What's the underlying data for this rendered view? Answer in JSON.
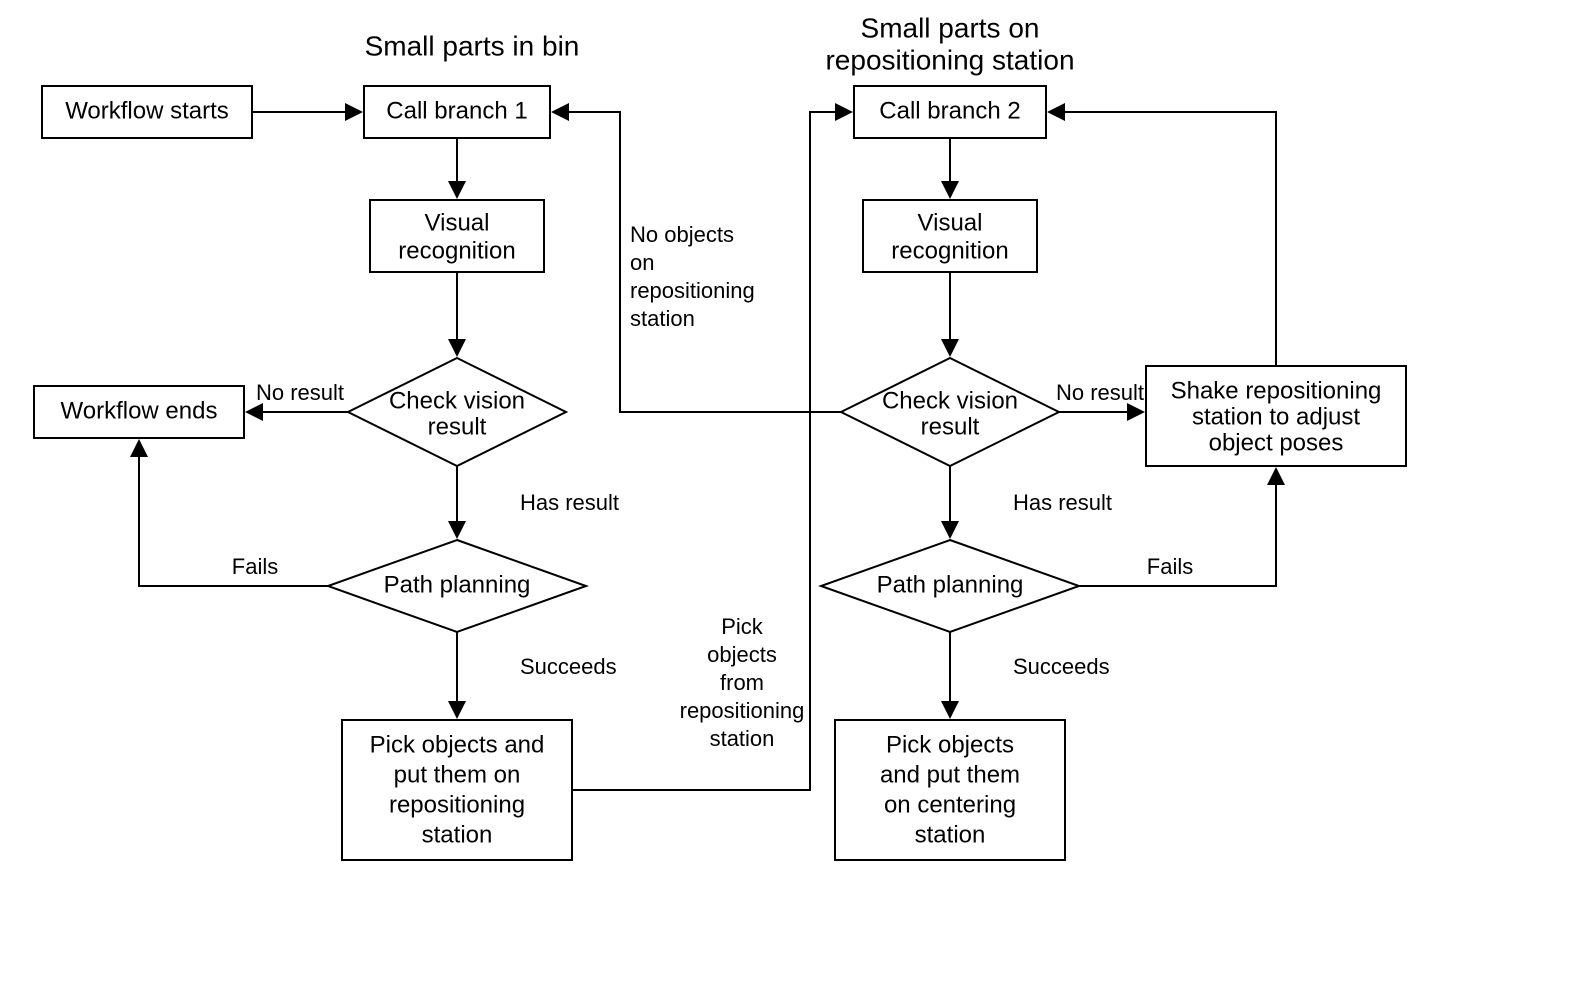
{
  "titles": {
    "left": "Small parts in bin",
    "right_l1": "Small parts on",
    "right_l2": "repositioning station"
  },
  "nodes": {
    "start": {
      "text": "Workflow starts"
    },
    "call1": {
      "text": "Call branch 1"
    },
    "vis1_l1": "Visual",
    "vis1_l2": "recognition",
    "chk1_l1": "Check vision",
    "chk1_l2": "result",
    "plan1": "Path planning",
    "pick1_l1": "Pick objects and",
    "pick1_l2": "put them on",
    "pick1_l3": "repositioning",
    "pick1_l4": "station",
    "end": {
      "text": "Workflow ends"
    },
    "call2": {
      "text": "Call branch 2"
    },
    "vis2_l1": "Visual",
    "vis2_l2": "recognition",
    "chk2_l1": "Check vision",
    "chk2_l2": "result",
    "plan2": "Path planning",
    "pick2_l1": "Pick objects",
    "pick2_l2": "and put them",
    "pick2_l3": "on centering",
    "pick2_l4": "station",
    "shake_l1": "Shake repositioning",
    "shake_l2": "station to adjust",
    "shake_l3": "object poses"
  },
  "labels": {
    "no_result": "No result",
    "has_result": "Has result",
    "fails": "Fails",
    "succeeds": "Succeeds",
    "noobj_l1": "No objects",
    "noobj_l2": "on",
    "noobj_l3": "repositioning",
    "noobj_l4": "station",
    "pickfrom_l1": "Pick",
    "pickfrom_l2": "objects",
    "pickfrom_l3": "from",
    "pickfrom_l4": "repositioning",
    "pickfrom_l5": "station"
  }
}
